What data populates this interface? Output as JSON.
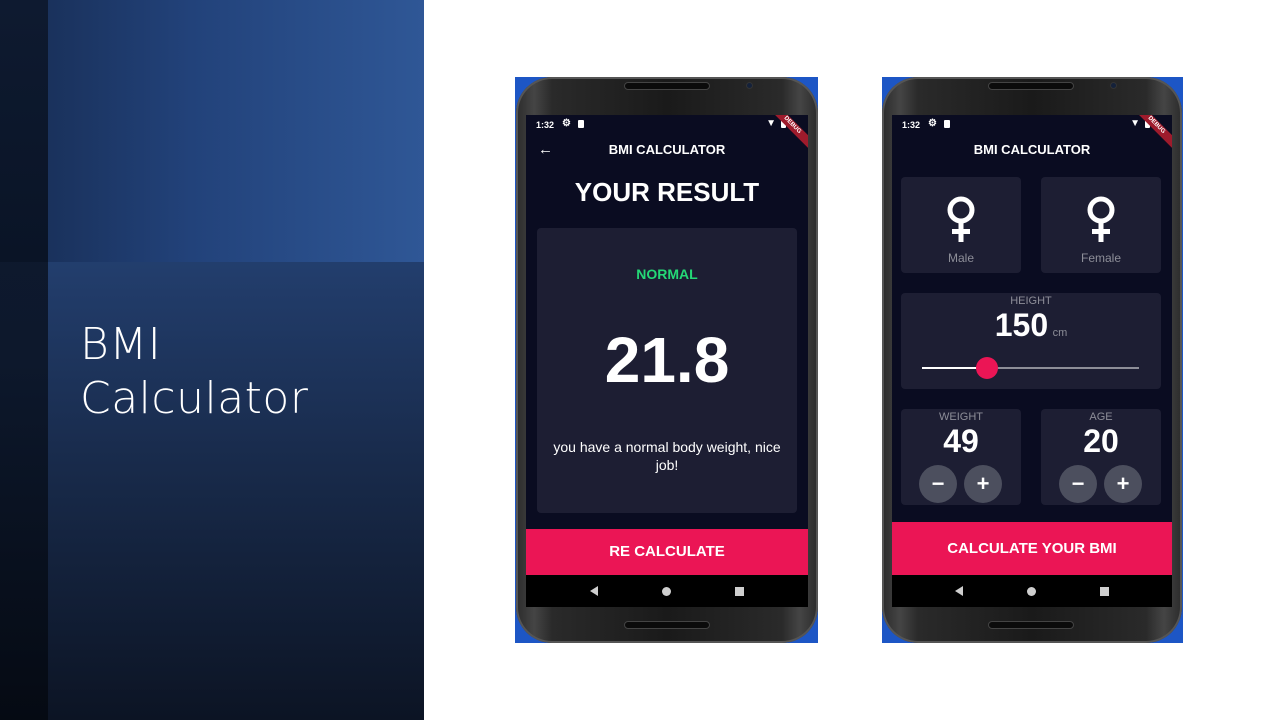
{
  "slide": {
    "title_line1": "BMI",
    "title_line2": "Calculator"
  },
  "colors": {
    "screen_bg": "#0a0c21",
    "card_bg": "#1d1e33",
    "accent": "#eb1555",
    "status_green": "#24d876",
    "label_grey": "#8d8e98"
  },
  "status_bar": {
    "time": "1:32",
    "debug_badge": "DEBUG"
  },
  "result_screen": {
    "app_title": "BMI CALCULATOR",
    "heading": "YOUR RESULT",
    "status": "NORMAL",
    "bmi_value": "21.8",
    "message": "you have a normal body weight, nice job!",
    "button_label": "RE CALCULATE",
    "icons": {
      "back": "back-arrow-icon"
    }
  },
  "input_screen": {
    "app_title": "BMI CALCULATOR",
    "gender_options": [
      {
        "label": "Male",
        "icon": "venus-icon"
      },
      {
        "label": "Female",
        "icon": "venus-icon"
      }
    ],
    "height": {
      "label": "HEIGHT",
      "value": "150",
      "unit": "cm",
      "slider_fraction": 0.3
    },
    "weight": {
      "label": "WEIGHT",
      "value": "49",
      "minus": "−",
      "plus": "+"
    },
    "age": {
      "label": "AGE",
      "value": "20",
      "minus": "−",
      "plus": "+"
    },
    "button_label": "CALCULATE YOUR BMI"
  }
}
